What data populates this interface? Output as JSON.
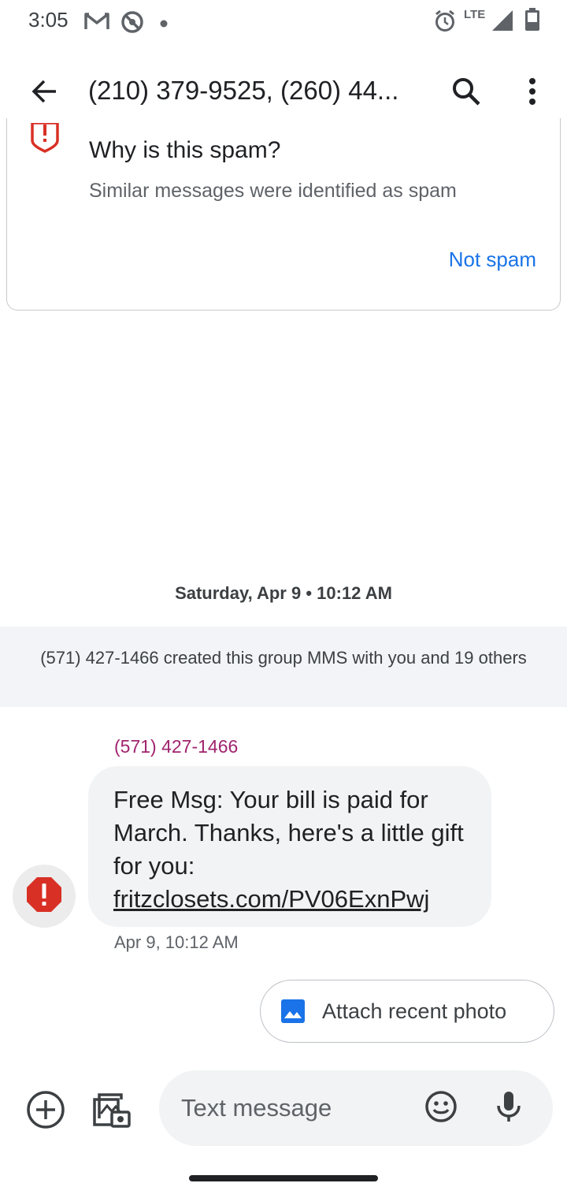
{
  "status_bar": {
    "time": "3:05",
    "network_label": "LTE",
    "icons": [
      "gmail-icon",
      "do-not-disturb-icon",
      "notification-dot-icon",
      "alarm-icon",
      "signal-icon",
      "battery-icon"
    ]
  },
  "app_bar": {
    "title": "(210) 379-9525, (260) 44...",
    "icons": [
      "back-arrow-icon",
      "search-icon",
      "more-vert-icon"
    ]
  },
  "spam_card": {
    "heading": "Why is this spam?",
    "description": "Similar messages were identified as spam",
    "action_label": "Not spam",
    "warning_color": "#d93025",
    "action_color": "#1a73e8"
  },
  "conversation": {
    "date_divider": "Saturday, Apr 9 • 10:12 AM",
    "group_notice": "(571) 427-1466 created this group MMS with you and 19 others",
    "messages": [
      {
        "sender": "(571) 427-1466",
        "text_prefix": "Free Msg: Your bill is paid for March. Thanks, here's a little gift for you: ",
        "link": "fritzclosets.com/PV06ExnPwj",
        "timestamp": "Apr 9, 10:12 AM",
        "sender_color": "#a0246e"
      }
    ]
  },
  "suggestion_chip": {
    "label": "Attach recent photo",
    "icon": "image-icon",
    "icon_color": "#1a73e8"
  },
  "compose": {
    "placeholder": "Text message",
    "value": "",
    "icons": [
      "add-circle-icon",
      "gallery-icon",
      "emoji-icon",
      "mic-icon"
    ]
  }
}
